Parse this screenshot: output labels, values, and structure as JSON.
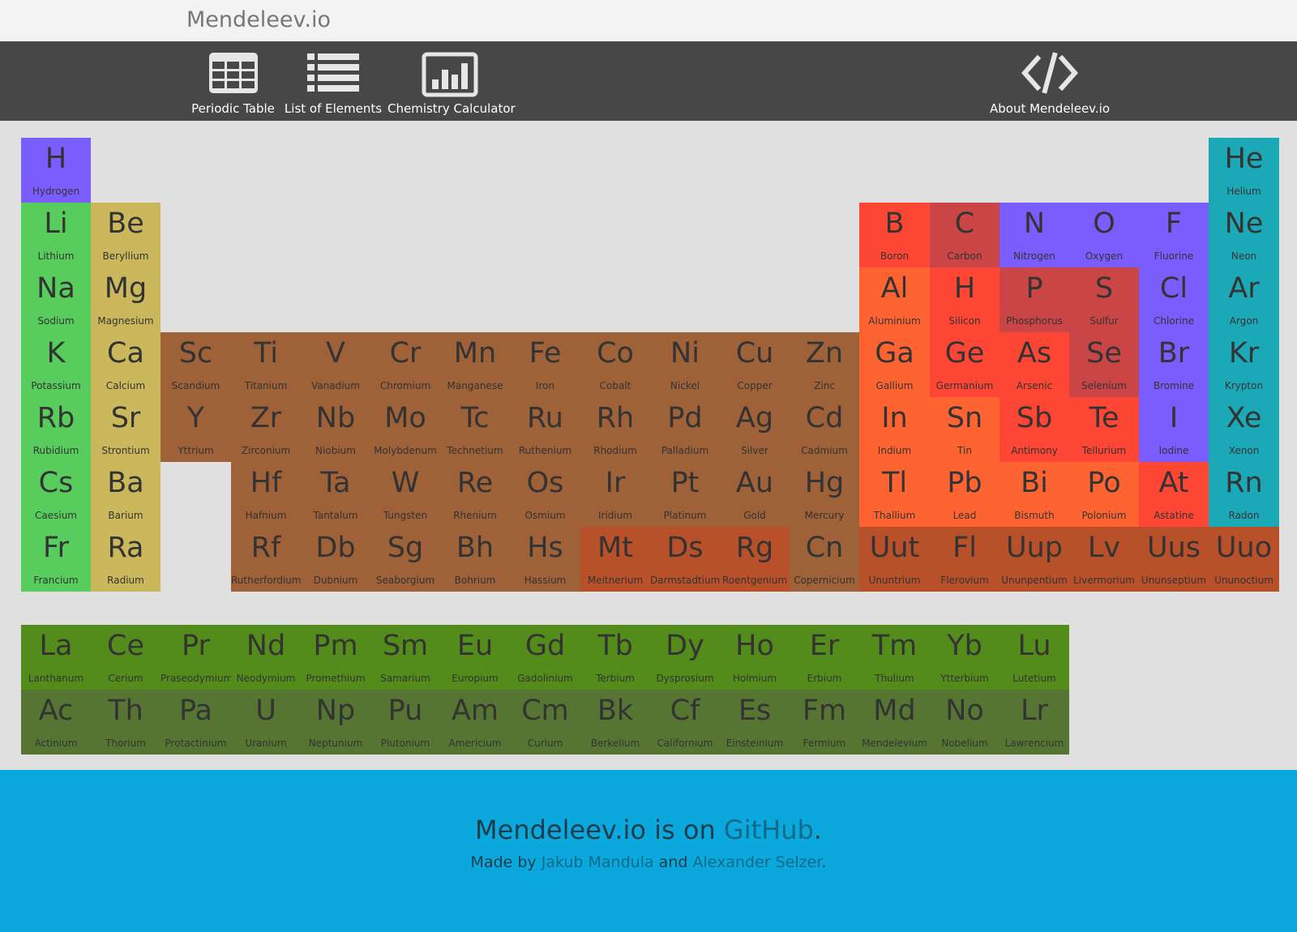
{
  "site_title": "Mendeleev.io",
  "nav": {
    "periodic_table": "Periodic Table",
    "list_of_elements": "List of Elements",
    "chemistry_calculator": "Chemistry Calculator",
    "about": "About Mendeleev.io"
  },
  "colors": {
    "alkali": "#58cc5c",
    "alkaline_earth": "#cbb85c",
    "transition": "#9e6138",
    "transition_dark": "#b8512a",
    "post_transition": "#fe6432",
    "metalloid": "#fe4634",
    "nonmetal": "#ca4545",
    "halogen_diatomic": "#7b5cfd",
    "noble_gas": "#1ba9b8",
    "lanthanide": "#538c1a",
    "actinide": "#567533",
    "unknown": "#b8512a"
  },
  "elements": [
    {
      "symbol": "H",
      "name": "Hydrogen",
      "row": 1,
      "col": 1,
      "color": "#7b5cfd"
    },
    {
      "symbol": "He",
      "name": "Helium",
      "row": 1,
      "col": 18,
      "color": "#1ba9b8"
    },
    {
      "symbol": "Li",
      "name": "Lithium",
      "row": 2,
      "col": 1,
      "color": "#58cc5c"
    },
    {
      "symbol": "Be",
      "name": "Beryllium",
      "row": 2,
      "col": 2,
      "color": "#cbb85c"
    },
    {
      "symbol": "B",
      "name": "Boron",
      "row": 2,
      "col": 13,
      "color": "#fe4634"
    },
    {
      "symbol": "C",
      "name": "Carbon",
      "row": 2,
      "col": 14,
      "color": "#ca4545"
    },
    {
      "symbol": "N",
      "name": "Nitrogen",
      "row": 2,
      "col": 15,
      "color": "#7b5cfd"
    },
    {
      "symbol": "O",
      "name": "Oxygen",
      "row": 2,
      "col": 16,
      "color": "#7b5cfd"
    },
    {
      "symbol": "F",
      "name": "Fluorine",
      "row": 2,
      "col": 17,
      "color": "#7b5cfd"
    },
    {
      "symbol": "Ne",
      "name": "Neon",
      "row": 2,
      "col": 18,
      "color": "#1ba9b8"
    },
    {
      "symbol": "Na",
      "name": "Sodium",
      "row": 3,
      "col": 1,
      "color": "#58cc5c"
    },
    {
      "symbol": "Mg",
      "name": "Magnesium",
      "row": 3,
      "col": 2,
      "color": "#cbb85c"
    },
    {
      "symbol": "Al",
      "name": "Aluminium",
      "row": 3,
      "col": 13,
      "color": "#fe6432"
    },
    {
      "symbol": "H",
      "name": "Silicon",
      "row": 3,
      "col": 14,
      "color": "#fe4634"
    },
    {
      "symbol": "P",
      "name": "Phosphorus",
      "row": 3,
      "col": 15,
      "color": "#ca4545"
    },
    {
      "symbol": "S",
      "name": "Sulfur",
      "row": 3,
      "col": 16,
      "color": "#ca4545"
    },
    {
      "symbol": "Cl",
      "name": "Chlorine",
      "row": 3,
      "col": 17,
      "color": "#7b5cfd"
    },
    {
      "symbol": "Ar",
      "name": "Argon",
      "row": 3,
      "col": 18,
      "color": "#1ba9b8"
    },
    {
      "symbol": "K",
      "name": "Potassium",
      "row": 4,
      "col": 1,
      "color": "#58cc5c"
    },
    {
      "symbol": "Ca",
      "name": "Calcium",
      "row": 4,
      "col": 2,
      "color": "#cbb85c"
    },
    {
      "symbol": "Sc",
      "name": "Scandium",
      "row": 4,
      "col": 3,
      "color": "#9e6138"
    },
    {
      "symbol": "Ti",
      "name": "Titanium",
      "row": 4,
      "col": 4,
      "color": "#9e6138"
    },
    {
      "symbol": "V",
      "name": "Vanadium",
      "row": 4,
      "col": 5,
      "color": "#9e6138"
    },
    {
      "symbol": "Cr",
      "name": "Chromium",
      "row": 4,
      "col": 6,
      "color": "#9e6138"
    },
    {
      "symbol": "Mn",
      "name": "Manganese",
      "row": 4,
      "col": 7,
      "color": "#9e6138"
    },
    {
      "symbol": "Fe",
      "name": "Iron",
      "row": 4,
      "col": 8,
      "color": "#9e6138"
    },
    {
      "symbol": "Co",
      "name": "Cobalt",
      "row": 4,
      "col": 9,
      "color": "#9e6138"
    },
    {
      "symbol": "Ni",
      "name": "Nickel",
      "row": 4,
      "col": 10,
      "color": "#9e6138"
    },
    {
      "symbol": "Cu",
      "name": "Copper",
      "row": 4,
      "col": 11,
      "color": "#9e6138"
    },
    {
      "symbol": "Zn",
      "name": "Zinc",
      "row": 4,
      "col": 12,
      "color": "#9e6138"
    },
    {
      "symbol": "Ga",
      "name": "Gallium",
      "row": 4,
      "col": 13,
      "color": "#fe6432"
    },
    {
      "symbol": "Ge",
      "name": "Germanium",
      "row": 4,
      "col": 14,
      "color": "#fe4634"
    },
    {
      "symbol": "As",
      "name": "Arsenic",
      "row": 4,
      "col": 15,
      "color": "#fe4634"
    },
    {
      "symbol": "Se",
      "name": "Selenium",
      "row": 4,
      "col": 16,
      "color": "#ca4545"
    },
    {
      "symbol": "Br",
      "name": "Bromine",
      "row": 4,
      "col": 17,
      "color": "#7b5cfd"
    },
    {
      "symbol": "Kr",
      "name": "Krypton",
      "row": 4,
      "col": 18,
      "color": "#1ba9b8"
    },
    {
      "symbol": "Rb",
      "name": "Rubidium",
      "row": 5,
      "col": 1,
      "color": "#58cc5c"
    },
    {
      "symbol": "Sr",
      "name": "Strontium",
      "row": 5,
      "col": 2,
      "color": "#cbb85c"
    },
    {
      "symbol": "Y",
      "name": "Yttrium",
      "row": 5,
      "col": 3,
      "color": "#9e6138"
    },
    {
      "symbol": "Zr",
      "name": "Zirconium",
      "row": 5,
      "col": 4,
      "color": "#9e6138"
    },
    {
      "symbol": "Nb",
      "name": "Niobium",
      "row": 5,
      "col": 5,
      "color": "#9e6138"
    },
    {
      "symbol": "Mo",
      "name": "Molybdenum",
      "row": 5,
      "col": 6,
      "color": "#9e6138"
    },
    {
      "symbol": "Tc",
      "name": "Technetium",
      "row": 5,
      "col": 7,
      "color": "#9e6138"
    },
    {
      "symbol": "Ru",
      "name": "Ruthenium",
      "row": 5,
      "col": 8,
      "color": "#9e6138"
    },
    {
      "symbol": "Rh",
      "name": "Rhodium",
      "row": 5,
      "col": 9,
      "color": "#9e6138"
    },
    {
      "symbol": "Pd",
      "name": "Palladium",
      "row": 5,
      "col": 10,
      "color": "#9e6138"
    },
    {
      "symbol": "Ag",
      "name": "Silver",
      "row": 5,
      "col": 11,
      "color": "#9e6138"
    },
    {
      "symbol": "Cd",
      "name": "Cadmium",
      "row": 5,
      "col": 12,
      "color": "#9e6138"
    },
    {
      "symbol": "In",
      "name": "Indium",
      "row": 5,
      "col": 13,
      "color": "#fe6432"
    },
    {
      "symbol": "Sn",
      "name": "Tin",
      "row": 5,
      "col": 14,
      "color": "#fe6432"
    },
    {
      "symbol": "Sb",
      "name": "Antimony",
      "row": 5,
      "col": 15,
      "color": "#fe4634"
    },
    {
      "symbol": "Te",
      "name": "Tellurium",
      "row": 5,
      "col": 16,
      "color": "#fe4634"
    },
    {
      "symbol": "I",
      "name": "Iodine",
      "row": 5,
      "col": 17,
      "color": "#7b5cfd"
    },
    {
      "symbol": "Xe",
      "name": "Xenon",
      "row": 5,
      "col": 18,
      "color": "#1ba9b8"
    },
    {
      "symbol": "Cs",
      "name": "Caesium",
      "row": 6,
      "col": 1,
      "color": "#58cc5c"
    },
    {
      "symbol": "Ba",
      "name": "Barium",
      "row": 6,
      "col": 2,
      "color": "#cbb85c"
    },
    {
      "symbol": "Hf",
      "name": "Hafnium",
      "row": 6,
      "col": 4,
      "color": "#9e6138"
    },
    {
      "symbol": "Ta",
      "name": "Tantalum",
      "row": 6,
      "col": 5,
      "color": "#9e6138"
    },
    {
      "symbol": "W",
      "name": "Tungsten",
      "row": 6,
      "col": 6,
      "color": "#9e6138"
    },
    {
      "symbol": "Re",
      "name": "Rhenium",
      "row": 6,
      "col": 7,
      "color": "#9e6138"
    },
    {
      "symbol": "Os",
      "name": "Osmium",
      "row": 6,
      "col": 8,
      "color": "#9e6138"
    },
    {
      "symbol": "Ir",
      "name": "Iridium",
      "row": 6,
      "col": 9,
      "color": "#9e6138"
    },
    {
      "symbol": "Pt",
      "name": "Platinum",
      "row": 6,
      "col": 10,
      "color": "#9e6138"
    },
    {
      "symbol": "Au",
      "name": "Gold",
      "row": 6,
      "col": 11,
      "color": "#9e6138"
    },
    {
      "symbol": "Hg",
      "name": "Mercury",
      "row": 6,
      "col": 12,
      "color": "#9e6138"
    },
    {
      "symbol": "Tl",
      "name": "Thallium",
      "row": 6,
      "col": 13,
      "color": "#fe6432"
    },
    {
      "symbol": "Pb",
      "name": "Lead",
      "row": 6,
      "col": 14,
      "color": "#fe6432"
    },
    {
      "symbol": "Bi",
      "name": "Bismuth",
      "row": 6,
      "col": 15,
      "color": "#fe6432"
    },
    {
      "symbol": "Po",
      "name": "Polonium",
      "row": 6,
      "col": 16,
      "color": "#fe6432"
    },
    {
      "symbol": "At",
      "name": "Astatine",
      "row": 6,
      "col": 17,
      "color": "#fe4634"
    },
    {
      "symbol": "Rn",
      "name": "Radon",
      "row": 6,
      "col": 18,
      "color": "#1ba9b8"
    },
    {
      "symbol": "Fr",
      "name": "Francium",
      "row": 7,
      "col": 1,
      "color": "#58cc5c"
    },
    {
      "symbol": "Ra",
      "name": "Radium",
      "row": 7,
      "col": 2,
      "color": "#cbb85c"
    },
    {
      "symbol": "Rf",
      "name": "Rutherfordium",
      "row": 7,
      "col": 4,
      "color": "#9e6138"
    },
    {
      "symbol": "Db",
      "name": "Dubnium",
      "row": 7,
      "col": 5,
      "color": "#9e6138"
    },
    {
      "symbol": "Sg",
      "name": "Seaborgium",
      "row": 7,
      "col": 6,
      "color": "#9e6138"
    },
    {
      "symbol": "Bh",
      "name": "Bohrium",
      "row": 7,
      "col": 7,
      "color": "#9e6138"
    },
    {
      "symbol": "Hs",
      "name": "Hassium",
      "row": 7,
      "col": 8,
      "color": "#9e6138"
    },
    {
      "symbol": "Mt",
      "name": "Meitnerium",
      "row": 7,
      "col": 9,
      "color": "#b8512a"
    },
    {
      "symbol": "Ds",
      "name": "Darmstadtium",
      "row": 7,
      "col": 10,
      "color": "#b8512a"
    },
    {
      "symbol": "Rg",
      "name": "Roentgenium",
      "row": 7,
      "col": 11,
      "color": "#b8512a"
    },
    {
      "symbol": "Cn",
      "name": "Copernicium",
      "row": 7,
      "col": 12,
      "color": "#9e6138"
    },
    {
      "symbol": "Uut",
      "name": "Ununtrium",
      "row": 7,
      "col": 13,
      "color": "#b8512a"
    },
    {
      "symbol": "Fl",
      "name": "Flerovium",
      "row": 7,
      "col": 14,
      "color": "#b8512a"
    },
    {
      "symbol": "Uup",
      "name": "Ununpentium",
      "row": 7,
      "col": 15,
      "color": "#b8512a"
    },
    {
      "symbol": "Lv",
      "name": "Livermorium",
      "row": 7,
      "col": 16,
      "color": "#b8512a"
    },
    {
      "symbol": "Uus",
      "name": "Ununseptium",
      "row": 7,
      "col": 17,
      "color": "#b8512a"
    },
    {
      "symbol": "Uuo",
      "name": "Ununoctium",
      "row": 7,
      "col": 18,
      "color": "#b8512a"
    },
    {
      "symbol": "La",
      "name": "Lanthanum",
      "row": 9,
      "col": 1,
      "color": "#538c1a"
    },
    {
      "symbol": "Ce",
      "name": "Cerium",
      "row": 9,
      "col": 2,
      "color": "#538c1a"
    },
    {
      "symbol": "Pr",
      "name": "Praseodymium",
      "row": 9,
      "col": 3,
      "color": "#538c1a"
    },
    {
      "symbol": "Nd",
      "name": "Neodymium",
      "row": 9,
      "col": 4,
      "color": "#538c1a"
    },
    {
      "symbol": "Pm",
      "name": "Promethium",
      "row": 9,
      "col": 5,
      "color": "#538c1a"
    },
    {
      "symbol": "Sm",
      "name": "Samarium",
      "row": 9,
      "col": 6,
      "color": "#538c1a"
    },
    {
      "symbol": "Eu",
      "name": "Europium",
      "row": 9,
      "col": 7,
      "color": "#538c1a"
    },
    {
      "symbol": "Gd",
      "name": "Gadolinium",
      "row": 9,
      "col": 8,
      "color": "#538c1a"
    },
    {
      "symbol": "Tb",
      "name": "Terbium",
      "row": 9,
      "col": 9,
      "color": "#538c1a"
    },
    {
      "symbol": "Dy",
      "name": "Dysprosium",
      "row": 9,
      "col": 10,
      "color": "#538c1a"
    },
    {
      "symbol": "Ho",
      "name": "Holmium",
      "row": 9,
      "col": 11,
      "color": "#538c1a"
    },
    {
      "symbol": "Er",
      "name": "Erbium",
      "row": 9,
      "col": 12,
      "color": "#538c1a"
    },
    {
      "symbol": "Tm",
      "name": "Thulium",
      "row": 9,
      "col": 13,
      "color": "#538c1a"
    },
    {
      "symbol": "Yb",
      "name": "Ytterbium",
      "row": 9,
      "col": 14,
      "color": "#538c1a"
    },
    {
      "symbol": "Lu",
      "name": "Lutetium",
      "row": 9,
      "col": 15,
      "color": "#538c1a"
    },
    {
      "symbol": "Ac",
      "name": "Actinium",
      "row": 10,
      "col": 1,
      "color": "#567533"
    },
    {
      "symbol": "Th",
      "name": "Thorium",
      "row": 10,
      "col": 2,
      "color": "#567533"
    },
    {
      "symbol": "Pa",
      "name": "Protactinium",
      "row": 10,
      "col": 3,
      "color": "#567533"
    },
    {
      "symbol": "U",
      "name": "Uranium",
      "row": 10,
      "col": 4,
      "color": "#567533"
    },
    {
      "symbol": "Np",
      "name": "Neptunium",
      "row": 10,
      "col": 5,
      "color": "#567533"
    },
    {
      "symbol": "Pu",
      "name": "Plutonium",
      "row": 10,
      "col": 6,
      "color": "#567533"
    },
    {
      "symbol": "Am",
      "name": "Americium",
      "row": 10,
      "col": 7,
      "color": "#567533"
    },
    {
      "symbol": "Cm",
      "name": "Curium",
      "row": 10,
      "col": 8,
      "color": "#567533"
    },
    {
      "symbol": "Bk",
      "name": "Berkelium",
      "row": 10,
      "col": 9,
      "color": "#567533"
    },
    {
      "symbol": "Cf",
      "name": "Californium",
      "row": 10,
      "col": 10,
      "color": "#567533"
    },
    {
      "symbol": "Es",
      "name": "Einsteinium",
      "row": 10,
      "col": 11,
      "color": "#567533"
    },
    {
      "symbol": "Fm",
      "name": "Fermium",
      "row": 10,
      "col": 12,
      "color": "#567533"
    },
    {
      "symbol": "Md",
      "name": "Mendelevium",
      "row": 10,
      "col": 13,
      "color": "#567533"
    },
    {
      "symbol": "No",
      "name": "Nobelium",
      "row": 10,
      "col": 14,
      "color": "#567533"
    },
    {
      "symbol": "Lr",
      "name": "Lawrencium",
      "row": 10,
      "col": 15,
      "color": "#567533"
    }
  ],
  "footer": {
    "line1_prefix": "Mendeleev.io is on ",
    "github_link": "GitHub",
    "line1_suffix": ".",
    "line2_prefix": "Made by ",
    "author1": "Jakub Mandula",
    "line2_and": " and ",
    "author2": "Alexander Selzer",
    "line2_suffix": "."
  }
}
